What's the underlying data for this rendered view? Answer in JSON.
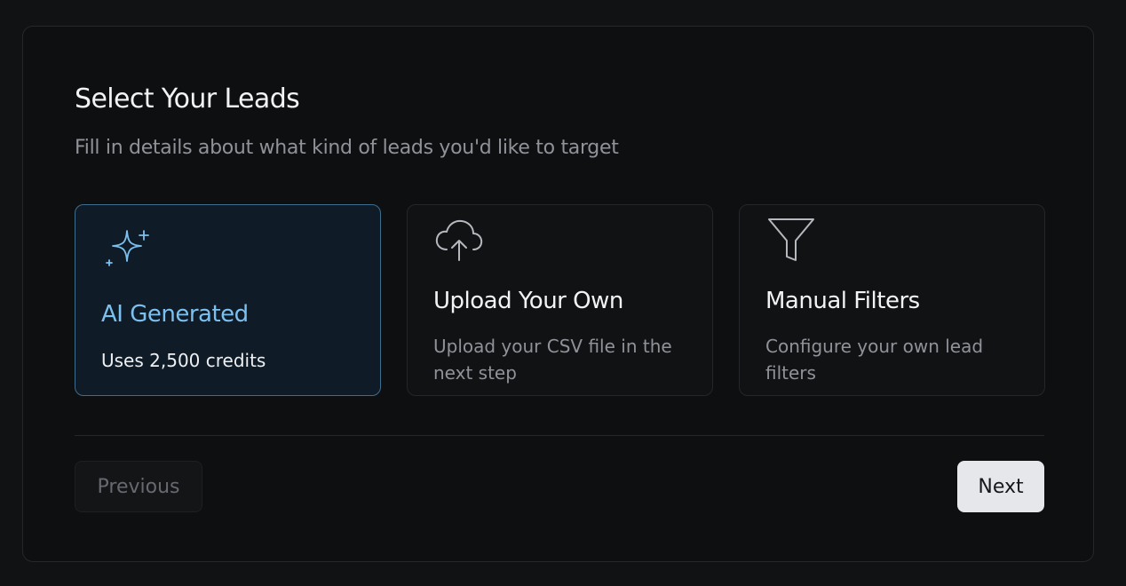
{
  "header": {
    "title": "Select Your Leads",
    "subtitle": "Fill in details about what kind of leads you'd like to target"
  },
  "options": [
    {
      "title": "AI Generated",
      "description": "Uses 2,500 credits",
      "icon": "sparkles-icon",
      "selected": true
    },
    {
      "title": "Upload Your Own",
      "description": "Upload your CSV file in the next step",
      "icon": "cloud-upload-icon",
      "selected": false
    },
    {
      "title": "Manual Filters",
      "description": "Configure your own lead filters",
      "icon": "filter-icon",
      "selected": false
    }
  ],
  "footer": {
    "previous_label": "Previous",
    "next_label": "Next"
  },
  "colors": {
    "accent": "#7cc0f0",
    "selected_border": "#3f6d90",
    "selected_bg": "#0f1c28",
    "background": "#0e0f11"
  }
}
